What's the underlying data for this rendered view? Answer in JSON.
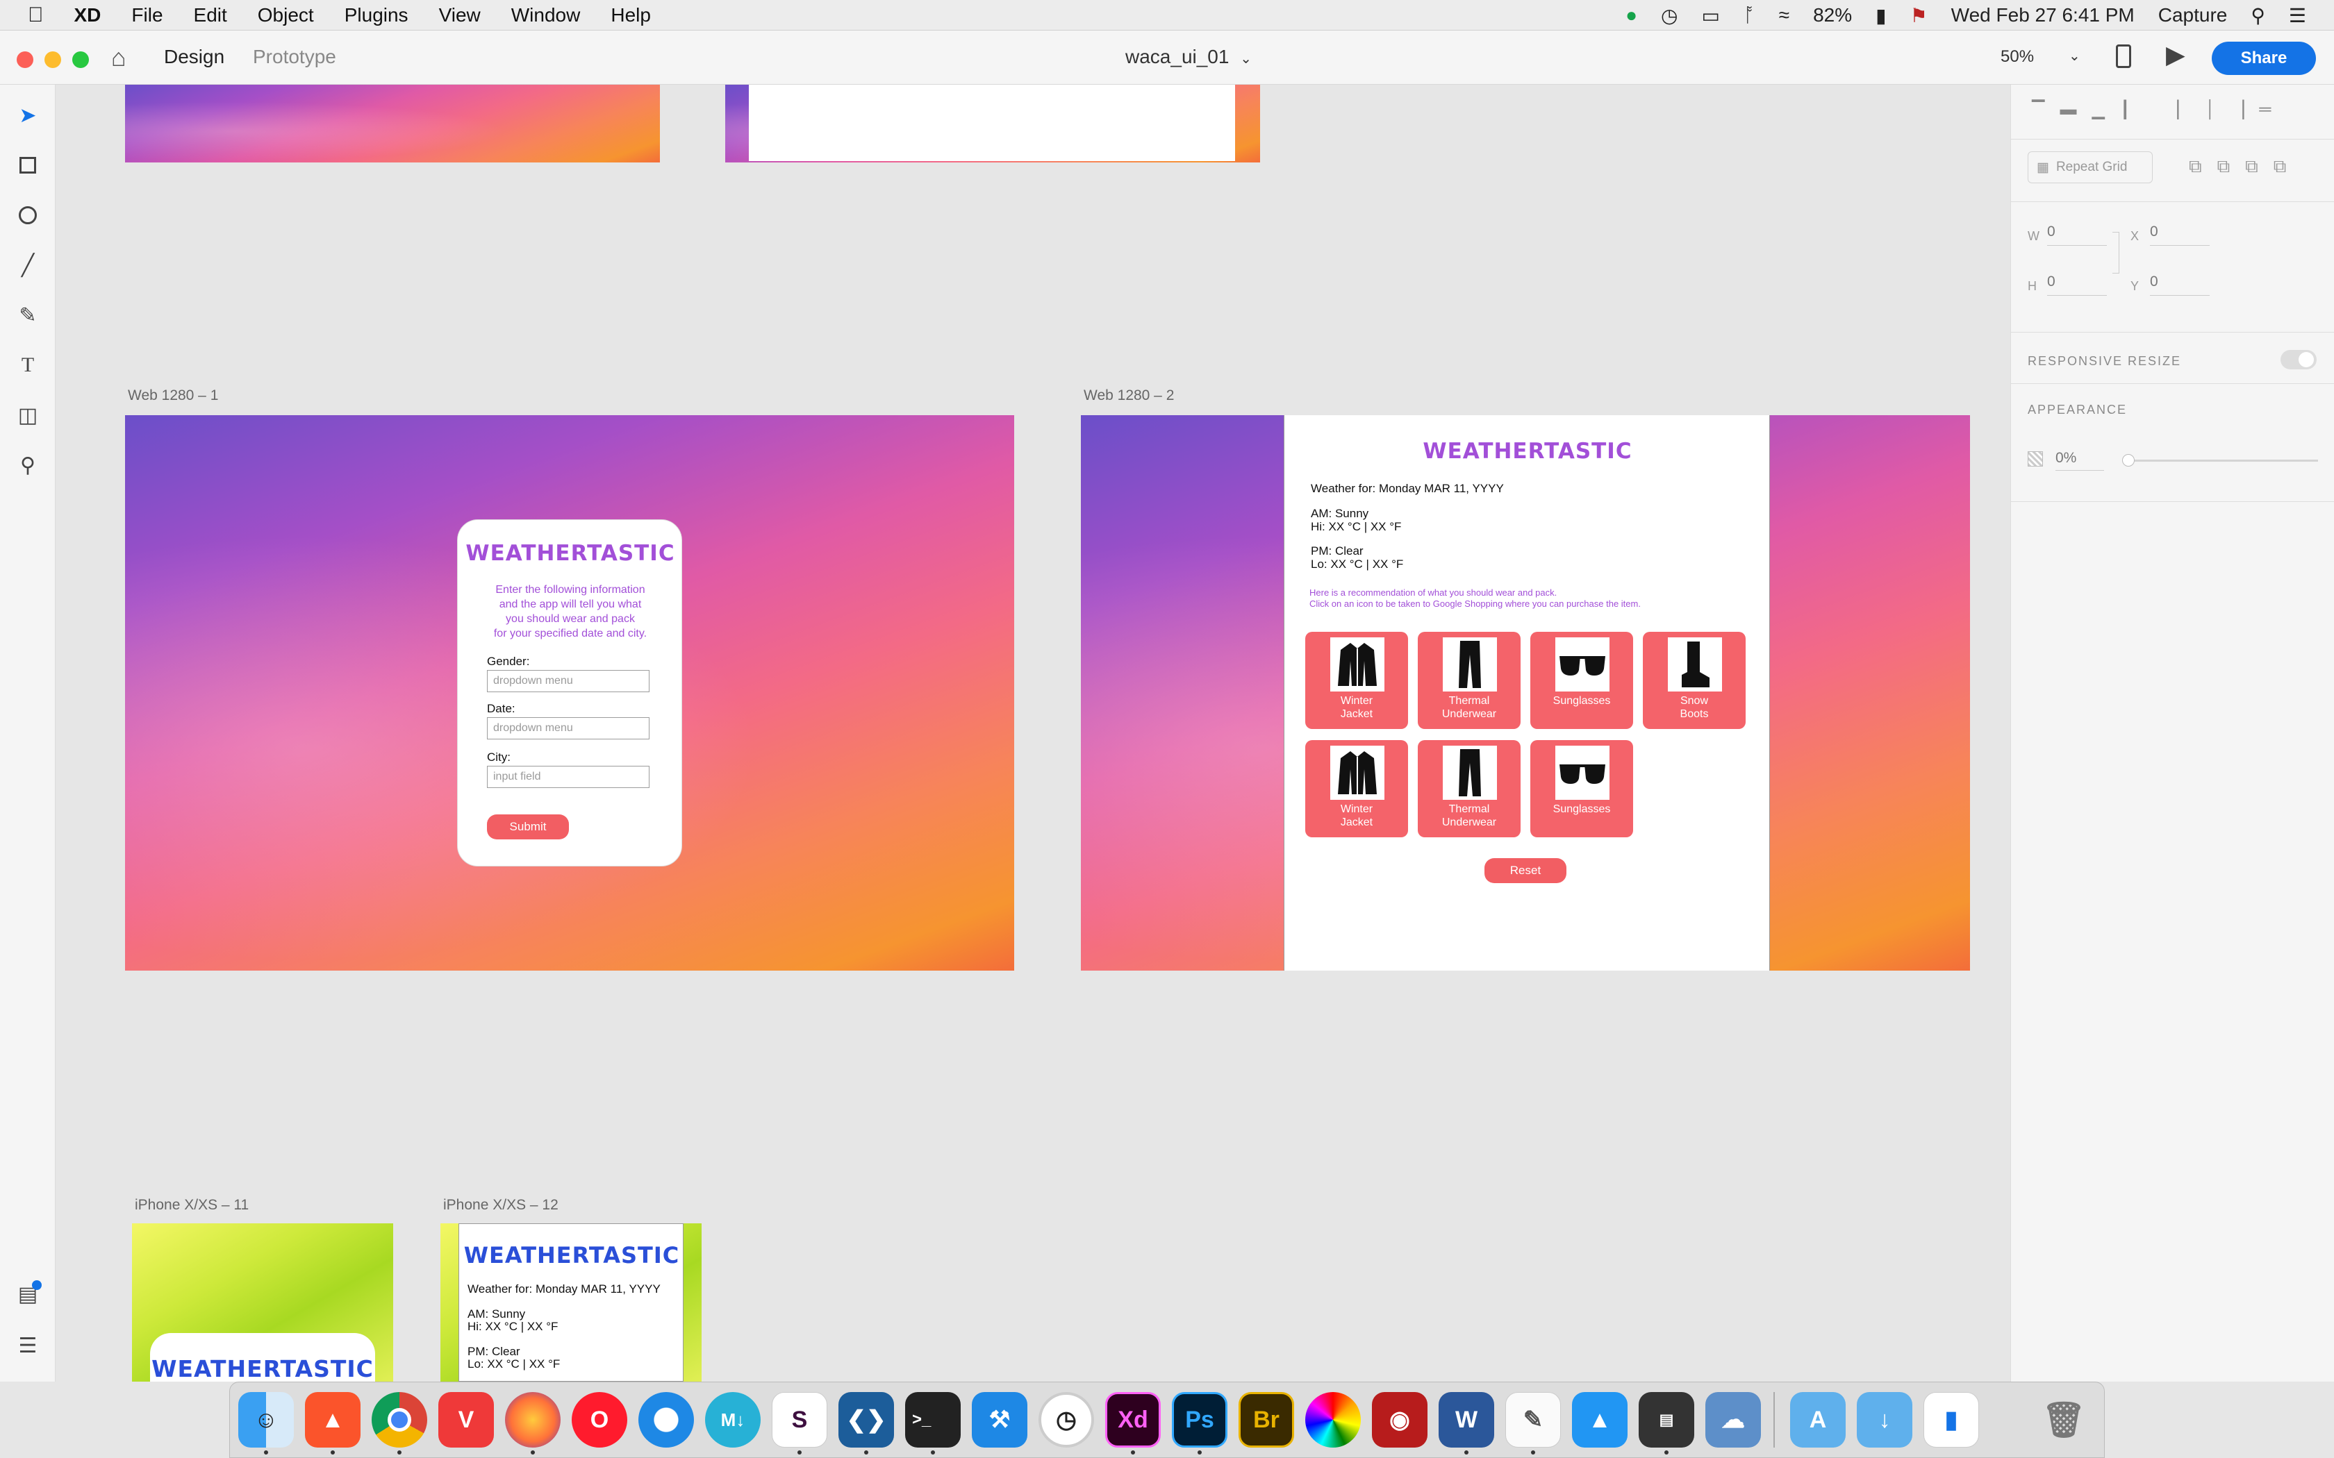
{
  "menubar": {
    "apple": "",
    "app": "XD",
    "items": [
      "File",
      "Edit",
      "Object",
      "Plugins",
      "View",
      "Window",
      "Help"
    ],
    "battery": "82%",
    "datetime": "Wed Feb 27  6:41 PM",
    "capture": "Capture"
  },
  "titlebar": {
    "tabs": [
      "Design",
      "Prototype"
    ],
    "doc_title": "waca_ui_01",
    "zoom": "50%",
    "share": "Share"
  },
  "right_panel": {
    "repeat_grid": "Repeat Grid",
    "w_label": "W",
    "w_value": "0",
    "x_label": "X",
    "x_value": "0",
    "h_label": "H",
    "h_value": "0",
    "y_label": "Y",
    "y_value": "0",
    "responsive_resize": "RESPONSIVE RESIZE",
    "appearance": "APPEARANCE",
    "opacity": "0%"
  },
  "artboards": {
    "web1": {
      "label": "Web 1280 – 1",
      "brand": "WEATHERTASTIC",
      "intro": [
        "Enter the following information",
        "and the app will tell you what",
        "you should wear and pack",
        "for your specified date and city."
      ],
      "gender_label": "Gender:",
      "gender_placeholder": "dropdown menu",
      "date_label": "Date:",
      "date_placeholder": "dropdown menu",
      "city_label": "City:",
      "city_placeholder": "input field",
      "submit": "Submit"
    },
    "web2": {
      "label": "Web 1280 – 2",
      "brand": "WEATHERTASTIC",
      "weather_for": "Weather for: Monday MAR 11, YYYY",
      "am": "AM: Sunny",
      "am_temp": "Hi: XX °C | XX °F",
      "pm": "PM: Clear",
      "pm_temp": "Lo: XX °C | XX °F",
      "rec1": "Here is a recommendation of what you should wear and pack.",
      "rec2": "Click on an icon to be taken to Google Shopping where you can purchase the item.",
      "tiles": [
        {
          "l1": "Winter",
          "l2": "Jacket",
          "icon": "jacket-icon"
        },
        {
          "l1": "Thermal",
          "l2": "Underwear",
          "icon": "pants-icon"
        },
        {
          "l1": "Sunglasses",
          "l2": "",
          "icon": "sunglasses-icon"
        },
        {
          "l1": "Snow",
          "l2": "Boots",
          "icon": "boot-icon"
        },
        {
          "l1": "Winter",
          "l2": "Jacket",
          "icon": "jacket-icon"
        },
        {
          "l1": "Thermal",
          "l2": "Underwear",
          "icon": "pants-icon"
        },
        {
          "l1": "Sunglasses",
          "l2": "",
          "icon": "sunglasses-icon"
        }
      ],
      "reset": "Reset"
    },
    "iphone11": {
      "label": "iPhone X/XS – 11",
      "brand": "WEATHERTASTIC"
    },
    "iphone12": {
      "label": "iPhone X/XS – 12",
      "brand": "WEATHERTASTIC",
      "weather_for": "Weather for: Monday MAR 11, YYYY",
      "am": "AM: Sunny",
      "am_temp": "Hi: XX °C | XX °F",
      "pm": "PM: Clear",
      "pm_temp": "Lo: XX °C | XX °F"
    }
  },
  "colors": {
    "accent": "#1473e6",
    "coral": "#f4636a",
    "purple": "#a24fd8",
    "brand_blue": "#2a4fd8"
  }
}
